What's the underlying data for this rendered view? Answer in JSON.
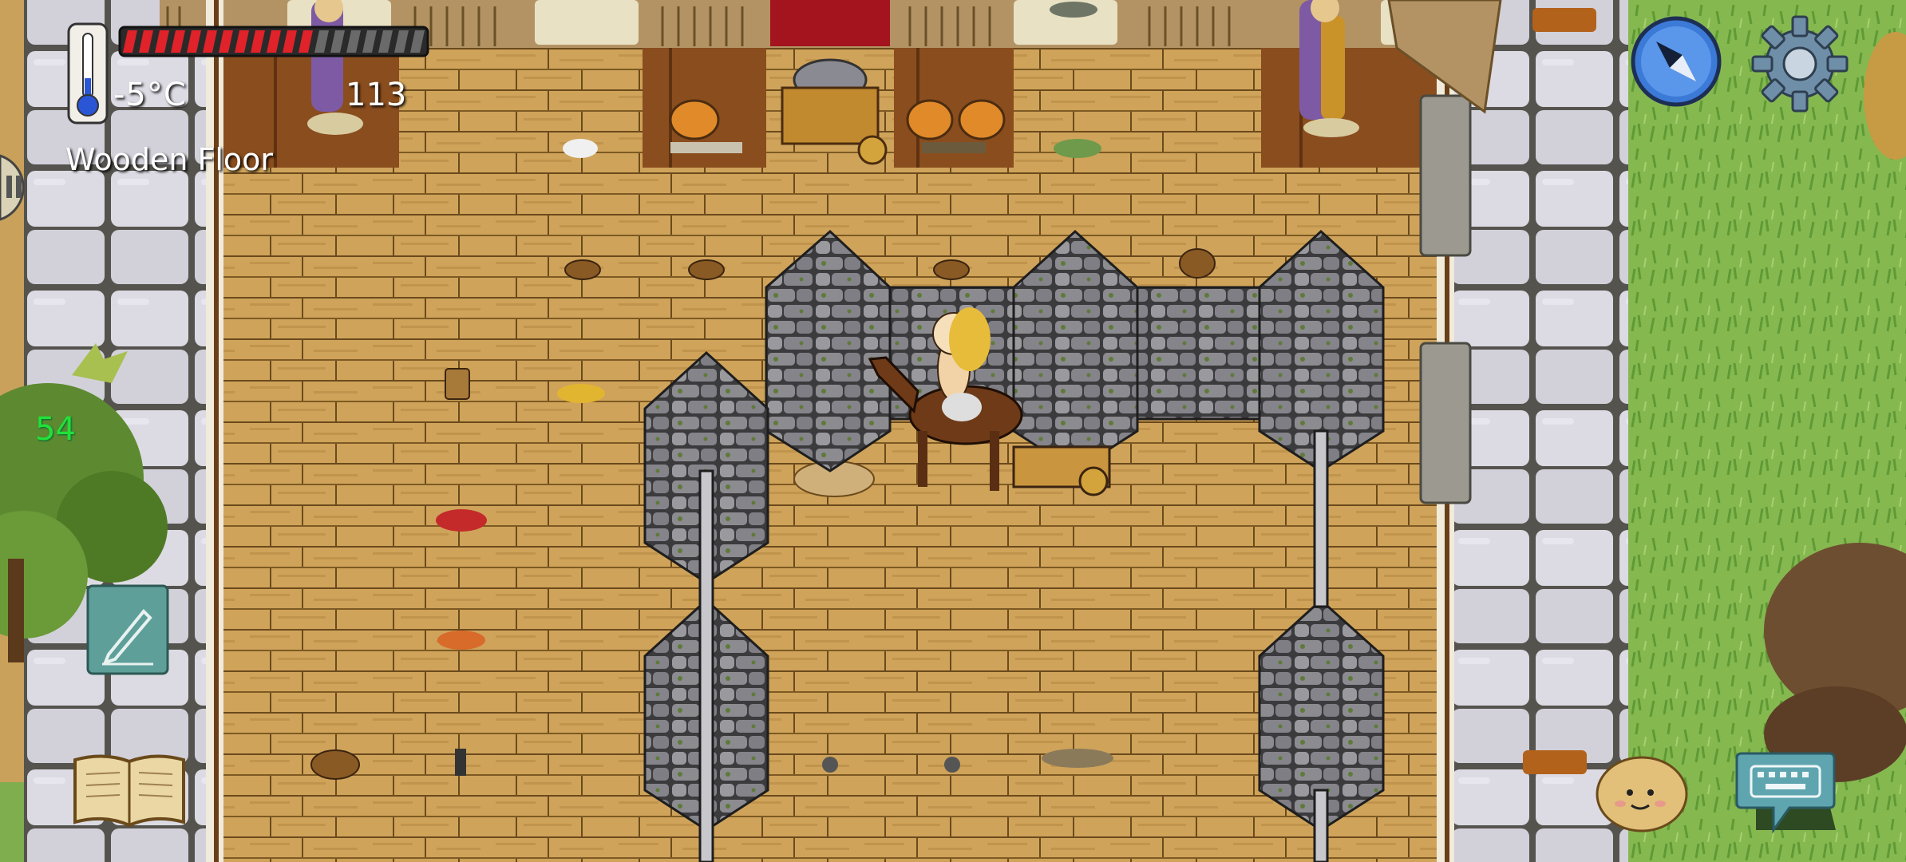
{
  "hud": {
    "temperature": "-5°C",
    "yum_counter": "113",
    "biome_label": "Wooden Floor",
    "age_label": "54",
    "food_pips_filled": 12,
    "food_pips_total": 19
  },
  "icons": {
    "thermometer": "thermometer-icon",
    "pause": "pause-icon",
    "compass": "compass-icon",
    "settings": "gear-icon",
    "notes": "pencil-note-icon",
    "recipe_book": "book-icon",
    "emote": "emote-face-icon",
    "chat": "keyboard-chat-icon"
  },
  "colors": {
    "food_filled": "#e0222a",
    "food_empty": "#6a6a6a",
    "age_text": "#22e03a",
    "wood_floor": "#c8a05a",
    "stone_floor": "#d6d4dc",
    "grass": "#86b850"
  }
}
